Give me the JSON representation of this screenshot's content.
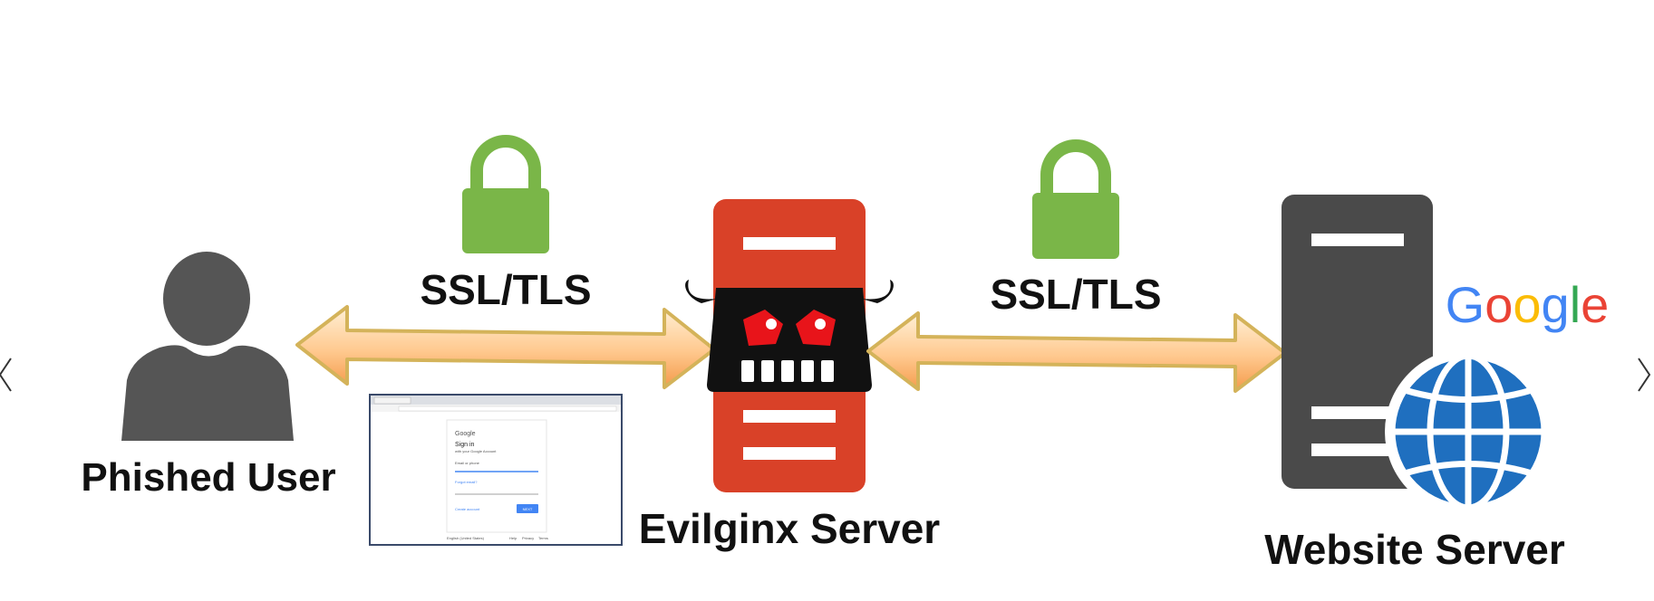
{
  "nodes": {
    "user": {
      "label": "Phished User"
    },
    "evilginx": {
      "label": "Evilginx Server"
    },
    "website": {
      "label": "Website Server"
    }
  },
  "links": [
    {
      "label": "SSL/TLS",
      "from": "Phished User",
      "to": "Evilginx Server"
    },
    {
      "label": "SSL/TLS",
      "from": "Evilginx Server",
      "to": "Website Server"
    }
  ],
  "brand_logo": "Google",
  "signin_thumbnail": {
    "logo": "Google",
    "heading": "Sign in",
    "subheading": "with your Google Account",
    "field_placeholder": "Email or phone",
    "forgot_link": "Forgot email?",
    "create_link": "Create account",
    "next_label": "NEXT",
    "language": "English (United States)",
    "footer_links": [
      "Help",
      "Privacy",
      "Terms"
    ]
  },
  "navigation": {
    "prev_icon": "chevron-left-icon",
    "next_icon": "chevron-right-icon"
  },
  "colors": {
    "person": "#555555",
    "lock": "#7ab648",
    "evil_server": "#d94128",
    "web_server": "#4a4a4a",
    "globe": "#1f6fbf",
    "arrow_fill_light": "#ffe1b8",
    "arrow_fill_dark": "#f7a45b",
    "arrow_stroke": "#d4b35a"
  }
}
